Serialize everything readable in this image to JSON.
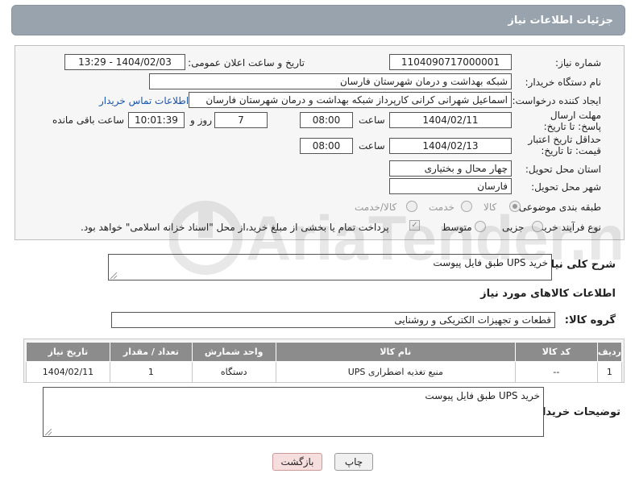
{
  "header": {
    "title": "جزئیات اطلاعات نیاز"
  },
  "form": {
    "need_number_label": "شماره نیاز:",
    "need_number": "1104090717000001",
    "announce_label": "تاریخ و ساعت اعلان عمومی:",
    "announce_value": "1404/02/03 - 13:29",
    "buyer_org_label": "نام دستگاه خریدار:",
    "buyer_org": "شبکه بهداشت و درمان شهرستان فارسان",
    "creator_label": "ایجاد کننده درخواست:",
    "creator": "اسماعیل شهرانی کرانی کارپرداز شبکه بهداشت و درمان شهرستان فارسان",
    "contact_link": "اطلاعات تماس خریدار",
    "reply_deadline_label": "مهلت ارسال پاسخ: تا تاریخ:",
    "reply_date": "1404/02/11",
    "time_label": "ساعت",
    "reply_time": "08:00",
    "days": "7",
    "days_label": "روز و",
    "remaining_time": "10:01:39",
    "remaining_label": "ساعت باقی مانده",
    "price_validity_label": "حداقل تاریخ اعتبار قیمت: تا تاریخ:",
    "price_date": "1404/02/13",
    "price_time": "08:00",
    "province_label": "استان محل تحویل:",
    "province": "چهار محال و بختیاری",
    "city_label": "شهر محل تحویل:",
    "city": "فارسان",
    "category_label": "طبقه بندی موضوعی:",
    "category_options": [
      "کالا",
      "خدمت",
      "کالا/خدمت"
    ],
    "category_selected": "کالا",
    "process_label": "نوع فرآیند خرید :",
    "process_options": [
      "جزیی",
      "متوسط"
    ],
    "payment_note": "پرداخت تمام یا بخشی از مبلغ خرید،از محل \"اسناد خزانه اسلامی\" خواهد بود."
  },
  "description": {
    "label": "شرح کلی نیاز:",
    "value": "خرید UPS طبق فایل پیوست"
  },
  "goods_info": {
    "title": "اطلاعات کالاهای مورد نیاز",
    "group_label": "گروه کالا:",
    "group_value": "قطعات و تجهیزات الکتریکی و روشنایی"
  },
  "table": {
    "headers": [
      "ردیف",
      "کد کالا",
      "نام کالا",
      "واحد شمارش",
      "تعداد / مقدار",
      "تاریخ نیاز"
    ],
    "rows": [
      [
        "1",
        "--",
        "منبع تغذیه اضطراری UPS",
        "دستگاه",
        "1",
        "1404/02/11"
      ]
    ]
  },
  "buyer_notes": {
    "label": "توضیحات خریدار:",
    "value": "خرید UPS طبق فایل پیوست"
  },
  "buttons": {
    "print": "چاپ",
    "back": "بازگشت"
  },
  "watermark": {
    "text": "AriaTender.net"
  }
}
